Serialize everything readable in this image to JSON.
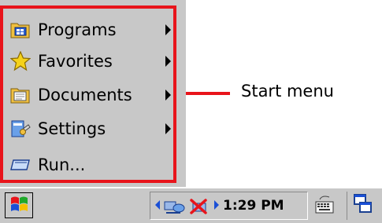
{
  "start_menu": {
    "items": [
      {
        "label": "Programs",
        "icon": "programs-folder-icon",
        "has_submenu": true
      },
      {
        "label": "Favorites",
        "icon": "favorites-star-icon",
        "has_submenu": true
      },
      {
        "label": "Documents",
        "icon": "documents-folder-icon",
        "has_submenu": true
      },
      {
        "label": "Settings",
        "icon": "settings-icon",
        "has_submenu": true
      },
      {
        "label": "Run...",
        "icon": "run-icon",
        "has_submenu": false
      }
    ]
  },
  "callout": {
    "label": "Start menu",
    "color": "#e8141b"
  },
  "taskbar": {
    "clock": "1:29 PM",
    "start_icon": "windows-flag-icon",
    "tray_icons": [
      "network-icon",
      "connection-error-icon"
    ],
    "keyboard_icon": "keyboard-icon",
    "desktop_icon": "show-desktop-icon"
  }
}
